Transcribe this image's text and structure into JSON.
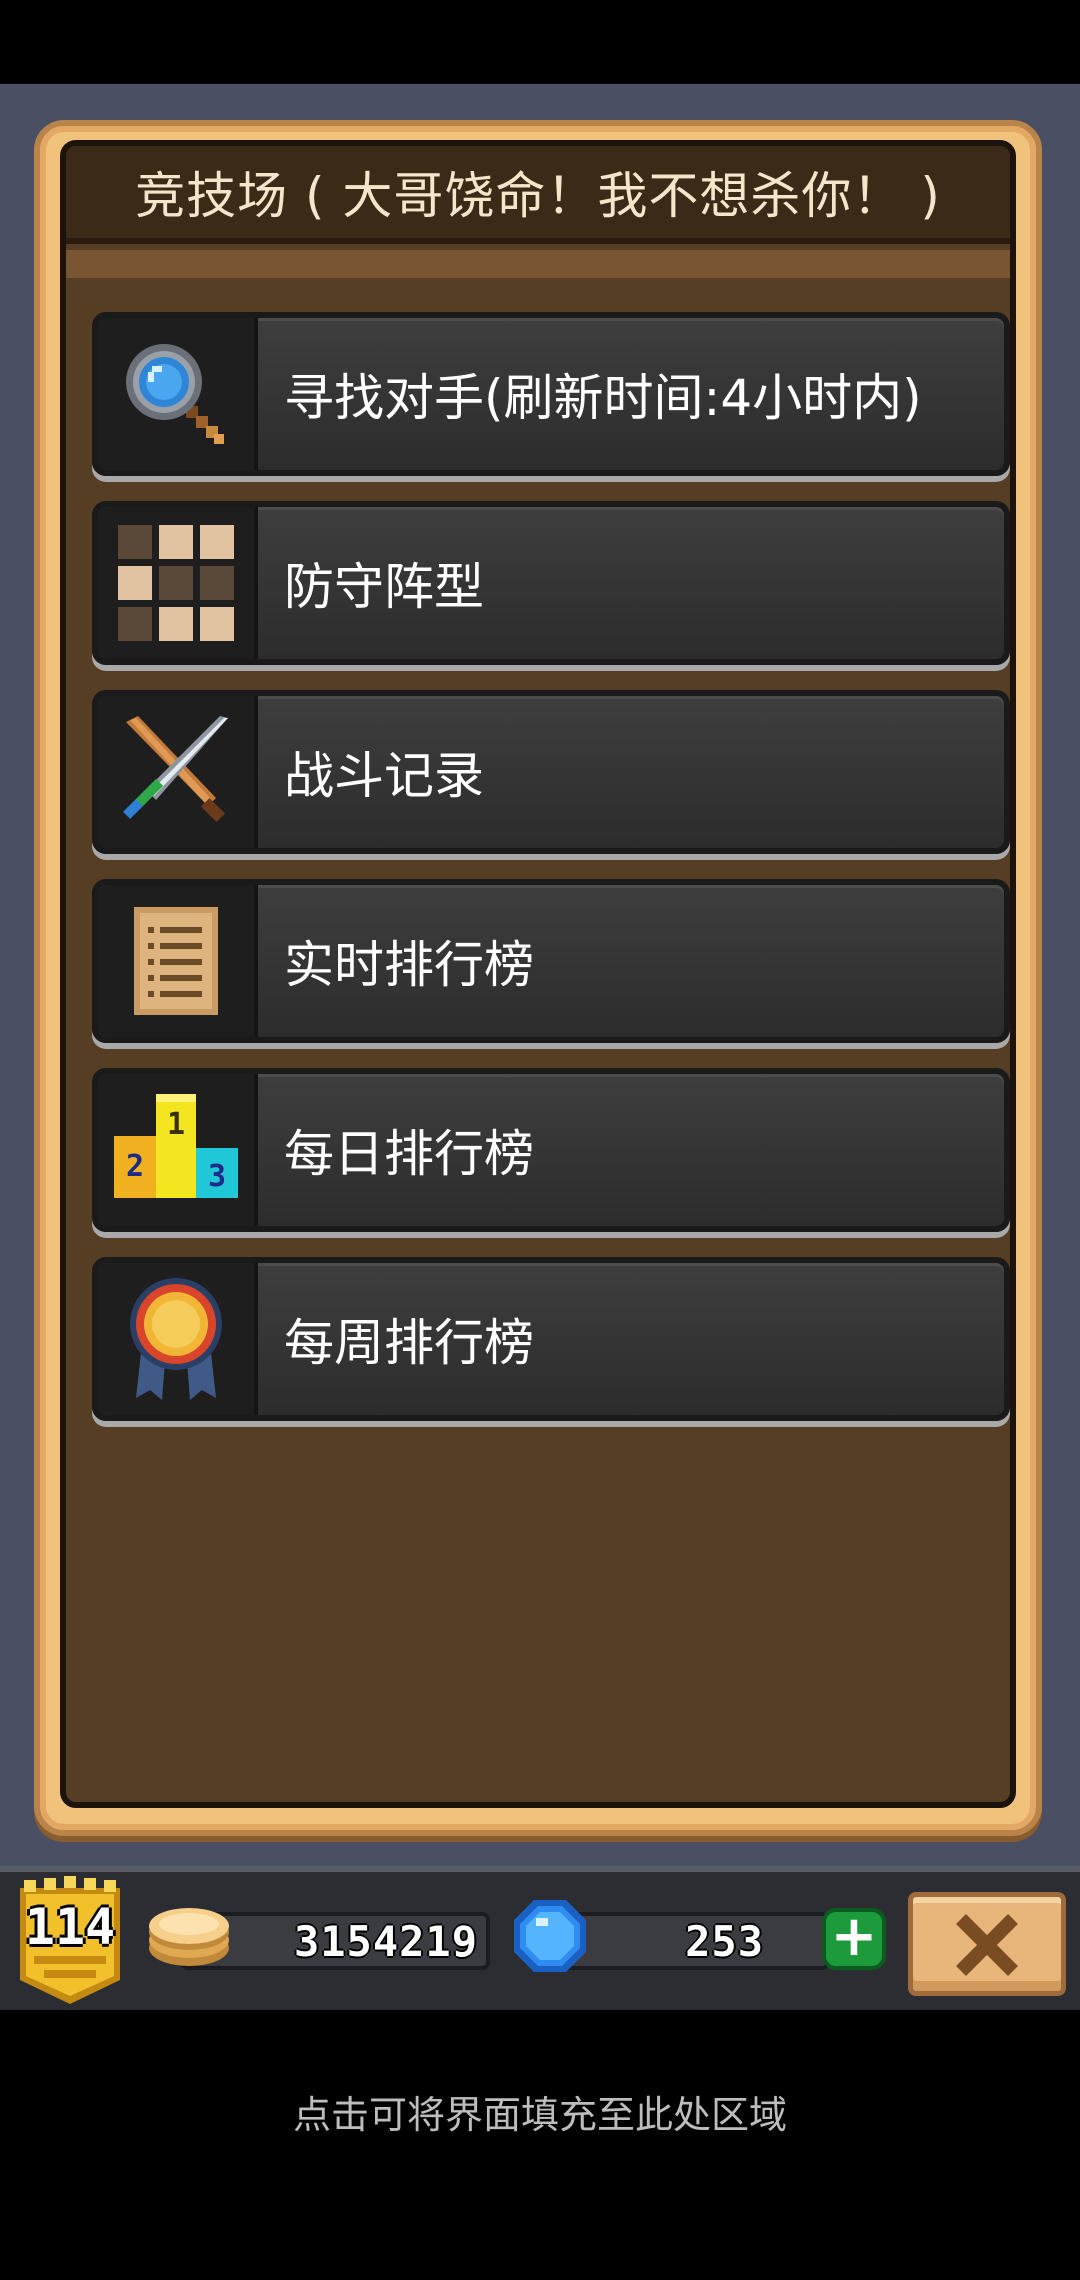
{
  "panel": {
    "title": "竞技场 ( 大哥饶命！我不想杀你！ )"
  },
  "menu": {
    "items": [
      {
        "label": "寻找对手(刷新时间:4小时内)",
        "icon": "magnifier-icon"
      },
      {
        "label": "防守阵型",
        "icon": "formation-grid-icon"
      },
      {
        "label": "战斗记录",
        "icon": "crossed-swords-icon"
      },
      {
        "label": "实时排行榜",
        "icon": "scroll-list-icon"
      },
      {
        "label": "每日排行榜",
        "icon": "podium-icon"
      },
      {
        "label": "每周排行榜",
        "icon": "medal-icon"
      }
    ]
  },
  "hud": {
    "level": "114",
    "coins": "3154219",
    "gems": "253",
    "add_button": "+",
    "close_icon": "close-icon"
  },
  "podium": {
    "first": "1",
    "second": "2",
    "third": "3"
  },
  "hint": {
    "text": "点击可将界面填充至此处区域"
  },
  "colors": {
    "frame_gold": "#f1c27c",
    "panel_brown": "#553e24",
    "button_dark": "#2f2f2f",
    "hud_bg": "#2b2d33",
    "add_green": "#1d9a3b"
  }
}
